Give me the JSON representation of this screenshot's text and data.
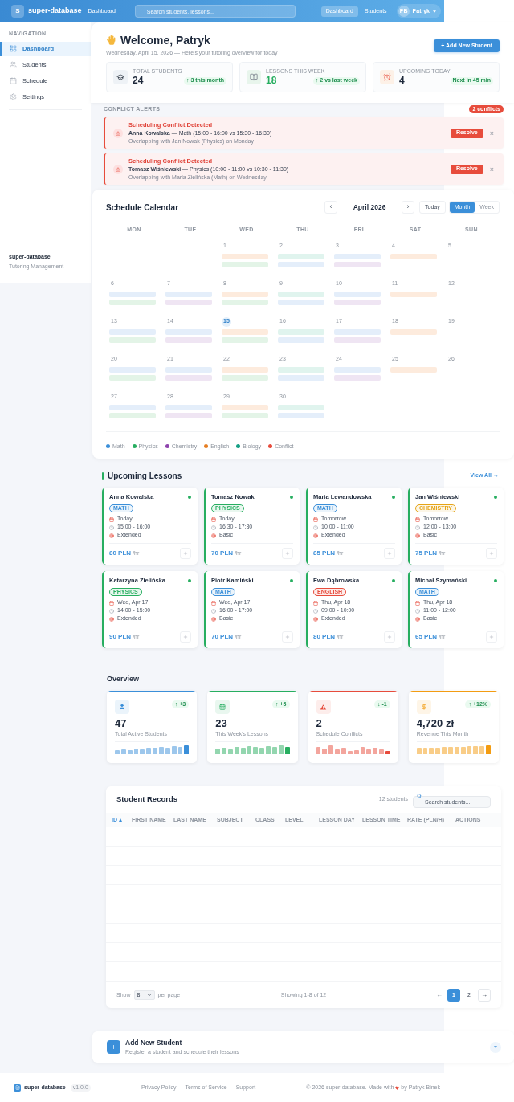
{
  "header": {
    "logo_letter": "S",
    "brand": "super-database",
    "breadcrumb": "Dashboard",
    "search": {
      "placeholder": "Search students, lessons..."
    },
    "nav": [
      {
        "label": "Dashboard",
        "selected": true
      },
      {
        "label": "Students",
        "selected": false
      }
    ],
    "user": {
      "initials": "PB",
      "name": "Patryk"
    }
  },
  "sidebar": {
    "section_label": "NAVIGATION",
    "items": [
      {
        "label": "Dashboard",
        "selected": true
      },
      {
        "label": "Students",
        "selected": false
      },
      {
        "label": "Schedule",
        "selected": false
      },
      {
        "label": "Settings",
        "selected": false
      }
    ],
    "footer": {
      "title": "super-database",
      "subtitle": "Tutoring Management"
    }
  },
  "welcome": {
    "title": "Welcome, Patryk",
    "subtitle": "Wednesday, April 15, 2026 — Here's your tutoring overview for today",
    "button": "+ Add New Student"
  },
  "stats": [
    {
      "label": "TOTAL STUDENTS",
      "value": "24",
      "badge": "↑ 3 this month",
      "color": "#1e293b"
    },
    {
      "label": "LESSONS THIS WEEK",
      "value": "18",
      "badge": "↑ 2 vs last week",
      "color": "#27ae60"
    },
    {
      "label": "UPCOMING TODAY",
      "value": "4",
      "badge": "Next in 45 min",
      "color": "#1e293b"
    }
  ],
  "conflicts": {
    "label": "CONFLICT ALERTS",
    "count_badge": "2 conflicts",
    "alerts": [
      {
        "title": "Scheduling Conflict Detected",
        "detail": "**Anna Kowalska** — Math (15:00 - 16:00 vs 15:30 - 16:30)",
        "note": "Overlapping with Jan Nowak (Physics) on Monday",
        "action": "Resolve",
        "dismiss": "×"
      },
      {
        "title": "Scheduling Conflict Detected",
        "detail": "**Tomasz Wiśniewski** — Physics (10:00 - 11:00 vs 10:30 - 11:30)",
        "note": "Overlapping with Maria Zielińska (Math) on Wednesday",
        "action": "Resolve",
        "dismiss": "×"
      }
    ]
  },
  "calendar": {
    "title": "Schedule Calendar",
    "prev": "‹",
    "month": "April 2026",
    "next": "›",
    "today": "Today",
    "views": [
      {
        "label": "Month",
        "selected": true
      },
      {
        "label": "Week",
        "selected": false
      }
    ],
    "weekdays": [
      "MON",
      "TUE",
      "WED",
      "THU",
      "FRI",
      "SAT",
      "SUN"
    ],
    "weeks": [
      [
        {
          "day": "1",
          "today": false,
          "events": [
            {
              "color": "#fdebdd"
            },
            {
              "color": "#e3f4e7"
            }
          ]
        },
        {
          "day": "2",
          "today": false,
          "events": [
            {
              "color": "#e0f4ee"
            },
            {
              "color": "#e4eefa"
            }
          ]
        },
        {
          "day": "3",
          "today": false,
          "events": [
            {
              "color": "#e4eefa"
            },
            {
              "color": "#efe5f3"
            }
          ]
        },
        {
          "day": "4",
          "today": false,
          "events": [
            {
              "color": "#fdebdd"
            }
          ]
        },
        {
          "day": "5",
          "today": false
        }
      ],
      [
        {
          "day": "6",
          "today": false,
          "events": [
            {
              "color": "#e4eefa"
            },
            {
              "color": "#e3f4e7"
            }
          ]
        },
        {
          "day": "7",
          "today": false,
          "events": [
            {
              "color": "#e4eefa"
            },
            {
              "color": "#efe5f3"
            }
          ]
        },
        {
          "day": "8",
          "today": false,
          "events": [
            {
              "color": "#fdebdd"
            },
            {
              "color": "#e3f4e7"
            }
          ]
        },
        {
          "day": "9",
          "today": false,
          "events": [
            {
              "color": "#e0f4ee"
            },
            {
              "color": "#e4eefa"
            }
          ]
        },
        {
          "day": "10",
          "today": false,
          "events": [
            {
              "color": "#e4eefa"
            },
            {
              "color": "#efe5f3"
            }
          ]
        },
        {
          "day": "11",
          "today": false,
          "events": [
            {
              "color": "#fdebdd"
            }
          ]
        },
        {
          "day": "12",
          "today": false
        }
      ],
      [
        {
          "day": "13",
          "today": false,
          "events": [
            {
              "color": "#e4eefa"
            },
            {
              "color": "#e3f4e7"
            }
          ]
        },
        {
          "day": "14",
          "today": false,
          "events": [
            {
              "color": "#e4eefa"
            },
            {
              "color": "#efe5f3"
            }
          ]
        },
        {
          "day": "15",
          "today": true,
          "events": [
            {
              "color": "#fdebdd"
            },
            {
              "color": "#e3f4e7"
            }
          ]
        },
        {
          "day": "16",
          "today": false,
          "events": [
            {
              "color": "#e0f4ee"
            },
            {
              "color": "#e4eefa"
            }
          ]
        },
        {
          "day": "17",
          "today": false,
          "events": [
            {
              "color": "#e4eefa"
            },
            {
              "color": "#efe5f3"
            }
          ]
        },
        {
          "day": "18",
          "today": false,
          "events": [
            {
              "color": "#fdebdd"
            }
          ]
        },
        {
          "day": "19",
          "today": false
        }
      ],
      [
        {
          "day": "20",
          "today": false,
          "events": [
            {
              "color": "#e4eefa"
            },
            {
              "color": "#e3f4e7"
            }
          ]
        },
        {
          "day": "21",
          "today": false,
          "events": [
            {
              "color": "#e4eefa"
            },
            {
              "color": "#efe5f3"
            }
          ]
        },
        {
          "day": "22",
          "today": false,
          "events": [
            {
              "color": "#fdebdd"
            },
            {
              "color": "#e3f4e7"
            }
          ]
        },
        {
          "day": "23",
          "today": false,
          "events": [
            {
              "color": "#e0f4ee"
            },
            {
              "color": "#e4eefa"
            }
          ]
        },
        {
          "day": "24",
          "today": false,
          "events": [
            {
              "color": "#e4eefa"
            },
            {
              "color": "#efe5f3"
            }
          ]
        },
        {
          "day": "25",
          "today": false,
          "events": [
            {
              "color": "#fdebdd"
            }
          ]
        },
        {
          "day": "26",
          "today": false
        }
      ],
      [
        {
          "day": "27",
          "today": false,
          "events": [
            {
              "color": "#e4eefa"
            },
            {
              "color": "#e3f4e7"
            }
          ]
        },
        {
          "day": "28",
          "today": false,
          "events": [
            {
              "color": "#e4eefa"
            },
            {
              "color": "#efe5f3"
            }
          ]
        },
        {
          "day": "29",
          "today": false,
          "events": [
            {
              "color": "#fdebdd"
            },
            {
              "color": "#e3f4e7"
            }
          ]
        },
        {
          "day": "30",
          "today": false,
          "events": [
            {
              "color": "#e0f4ee"
            },
            {
              "color": "#e4eefa"
            }
          ]
        }
      ]
    ],
    "legend": [
      {
        "label": "Math",
        "color": "#3b8fd9"
      },
      {
        "label": "Physics",
        "color": "#27ae60"
      },
      {
        "label": "Chemistry",
        "color": "#8e44ad"
      },
      {
        "label": "English",
        "color": "#e67e22"
      },
      {
        "label": "Biology",
        "color": "#16a085"
      },
      {
        "label": "Conflict",
        "color": "#e74c3c"
      }
    ]
  },
  "lessons": {
    "title": "Upcoming Lessons",
    "view_all": "View All →",
    "cards": [
      {
        "name": "Anna Kowalska",
        "subject": "MATH",
        "color": "#3b8fd9",
        "day": "Today",
        "time": "15:00 - 16:00",
        "level": "Extended",
        "price": "80 PLN",
        "unit": "/hr"
      },
      {
        "name": "Tomasz Nowak",
        "subject": "PHYSICS",
        "color": "#27ae60",
        "day": "Today",
        "time": "16:30 - 17:30",
        "level": "Basic",
        "price": "70 PLN",
        "unit": "/hr"
      },
      {
        "name": "Maria Lewandowska",
        "subject": "MATH",
        "color": "#3b8fd9",
        "day": "Tomorrow",
        "time": "10:00 - 11:00",
        "level": "Extended",
        "price": "85 PLN",
        "unit": "/hr"
      },
      {
        "name": "Jan Wiśniewski",
        "subject": "CHEMISTRY",
        "color": "#e6a417",
        "day": "Tomorrow",
        "time": "12:00 - 13:00",
        "level": "Basic",
        "price": "75 PLN",
        "unit": "/hr"
      },
      {
        "name": "Katarzyna Zielińska",
        "subject": "PHYSICS",
        "color": "#27ae60",
        "day": "Wed, Apr 17",
        "time": "14:00 - 15:00",
        "level": "Extended",
        "price": "90 PLN",
        "unit": "/hr"
      },
      {
        "name": "Piotr Kamiński",
        "subject": "MATH",
        "color": "#3b8fd9",
        "day": "Wed, Apr 17",
        "time": "16:00 - 17:00",
        "level": "Basic",
        "price": "70 PLN",
        "unit": "/hr"
      },
      {
        "name": "Ewa Dąbrowska",
        "subject": "ENGLISH",
        "color": "#e74c3c",
        "day": "Thu, Apr 18",
        "time": "09:00 - 10:00",
        "level": "Extended",
        "price": "80 PLN",
        "unit": "/hr"
      },
      {
        "name": "Michał Szymański",
        "subject": "MATH",
        "color": "#3b8fd9",
        "day": "Thu, Apr 18",
        "time": "11:00 - 12:00",
        "level": "Basic",
        "price": "65 PLN",
        "unit": "/hr"
      }
    ]
  },
  "overview": {
    "title": "Overview",
    "cards": [
      {
        "value": "47",
        "label": "Total Active Students",
        "trend": "↑ +3",
        "color": "#3b8fd9"
      },
      {
        "value": "23",
        "label": "This Week's Lessons",
        "trend": "↑ +5",
        "color": "#27ae60"
      },
      {
        "value": "2",
        "label": "Schedule Conflicts",
        "trend": "↓ -1",
        "color": "#e74c3c"
      },
      {
        "value": "4,720 zł",
        "label": "Revenue This Month",
        "trend": "↑ +12%",
        "color": "#f39c12"
      }
    ]
  },
  "student_records": {
    "title": "Student Records",
    "count": "12 students",
    "search": {
      "placeholder": "Search students..."
    },
    "columns": [
      {
        "label": "ID",
        "sorted": true
      },
      {
        "label": "FIRST NAME",
        "sorted": false
      },
      {
        "label": "LAST NAME",
        "sorted": false
      },
      {
        "label": "SUBJECT",
        "sorted": false
      },
      {
        "label": "CLASS",
        "sorted": false
      },
      {
        "label": "LEVEL",
        "sorted": false
      },
      {
        "label": "LESSON DAY",
        "sorted": false
      },
      {
        "label": "LESSON TIME",
        "sorted": false
      },
      {
        "label": "RATE (PLN/H)",
        "sorted": false
      },
      {
        "label": "ACTIONS",
        "sorted": false
      }
    ],
    "footer": {
      "show": "Show",
      "page_size": "8",
      "per_page": "per page",
      "showing": "Showing 1-8 of 12",
      "prev": {
        "label": "←",
        "disabled": true
      },
      "pages": [
        {
          "label": "1",
          "selected": true
        },
        {
          "label": "2",
          "selected": false
        }
      ],
      "next": {
        "label": "→",
        "disabled": false
      }
    }
  },
  "add_student_panel": {
    "title": "Add New Student",
    "subtitle": "Register a student and schedule their lessons",
    "expanded": false
  },
  "footer": {
    "brand": "super-database",
    "version": "v1.0.0",
    "links": [
      "Privacy Policy",
      "Terms of Service",
      "Support"
    ],
    "copyright": "© 2026 super-database. Made with",
    "author": "by Patryk Binek"
  }
}
